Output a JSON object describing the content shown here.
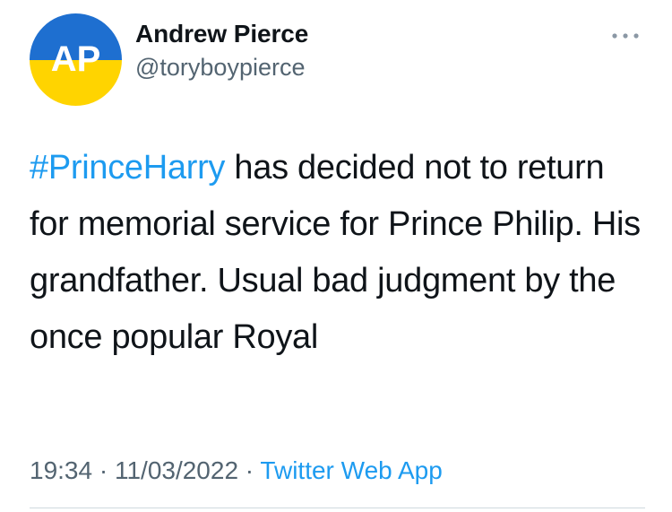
{
  "author": {
    "avatar_text": "AP",
    "avatar_colors": {
      "top": "#1e6fd0",
      "bottom": "#ffd400",
      "text": "#ffffff"
    },
    "display_name": "Andrew Pierce",
    "handle": "@toryboypierce"
  },
  "menu": {
    "icon": "more-horizontal-icon"
  },
  "tweet": {
    "hashtag": "#PrinceHarry",
    "body_after_hashtag": " has decided not to return for memorial service for Prince Philip. His grandfather. Usual bad judgment by the once popular Royal"
  },
  "meta": {
    "time": "19:34",
    "separator_1": " · ",
    "date": "11/03/2022",
    "separator_2": " · ",
    "source": "Twitter Web App"
  },
  "colors": {
    "link": "#1d9bf0",
    "secondary_text": "#536471",
    "primary_text": "#0f1419",
    "divider": "#cfd9de"
  }
}
